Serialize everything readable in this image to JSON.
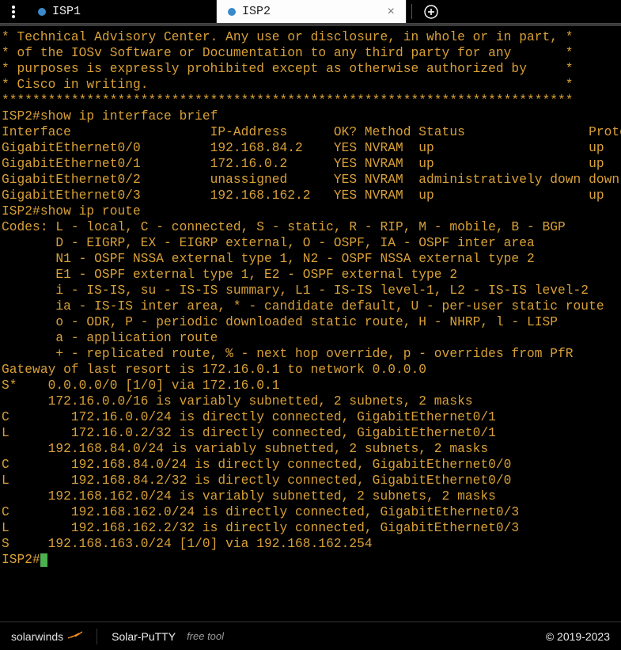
{
  "tabs": [
    {
      "title": "ISP1",
      "active": false
    },
    {
      "title": "ISP2",
      "active": true
    }
  ],
  "terminal": {
    "lines": [
      "* Technical Advisory Center. Any use or disclosure, in whole or in part, *",
      "* of the IOSv Software or Documentation to any third party for any       *",
      "* purposes is expressly prohibited except as otherwise authorized by     *",
      "* Cisco in writing.                                                      *",
      "**************************************************************************",
      "ISP2#show ip interface brief",
      "Interface                  IP-Address      OK? Method Status                Protocol",
      "GigabitEthernet0/0         192.168.84.2    YES NVRAM  up                    up",
      "GigabitEthernet0/1         172.16.0.2      YES NVRAM  up                    up",
      "GigabitEthernet0/2         unassigned      YES NVRAM  administratively down down",
      "GigabitEthernet0/3         192.168.162.2   YES NVRAM  up                    up",
      "ISP2#show ip route",
      "Codes: L - local, C - connected, S - static, R - RIP, M - mobile, B - BGP",
      "       D - EIGRP, EX - EIGRP external, O - OSPF, IA - OSPF inter area",
      "       N1 - OSPF NSSA external type 1, N2 - OSPF NSSA external type 2",
      "       E1 - OSPF external type 1, E2 - OSPF external type 2",
      "       i - IS-IS, su - IS-IS summary, L1 - IS-IS level-1, L2 - IS-IS level-2",
      "       ia - IS-IS inter area, * - candidate default, U - per-user static route",
      "       o - ODR, P - periodic downloaded static route, H - NHRP, l - LISP",
      "       a - application route",
      "       + - replicated route, % - next hop override, p - overrides from PfR",
      "",
      "Gateway of last resort is 172.16.0.1 to network 0.0.0.0",
      "",
      "S*    0.0.0.0/0 [1/0] via 172.16.0.1",
      "      172.16.0.0/16 is variably subnetted, 2 subnets, 2 masks",
      "C        172.16.0.0/24 is directly connected, GigabitEthernet0/1",
      "L        172.16.0.2/32 is directly connected, GigabitEthernet0/1",
      "      192.168.84.0/24 is variably subnetted, 2 subnets, 2 masks",
      "C        192.168.84.0/24 is directly connected, GigabitEthernet0/0",
      "L        192.168.84.2/32 is directly connected, GigabitEthernet0/0",
      "      192.168.162.0/24 is variably subnetted, 2 subnets, 2 masks",
      "C        192.168.162.0/24 is directly connected, GigabitEthernet0/3",
      "L        192.168.162.2/32 is directly connected, GigabitEthernet0/3",
      "S     192.168.163.0/24 [1/0] via 192.168.162.254"
    ],
    "prompt": "ISP2#"
  },
  "footer": {
    "brand": "solarwinds",
    "product": "Solar-PuTTY",
    "free": "free tool",
    "copyright": "© 2019-2023"
  }
}
